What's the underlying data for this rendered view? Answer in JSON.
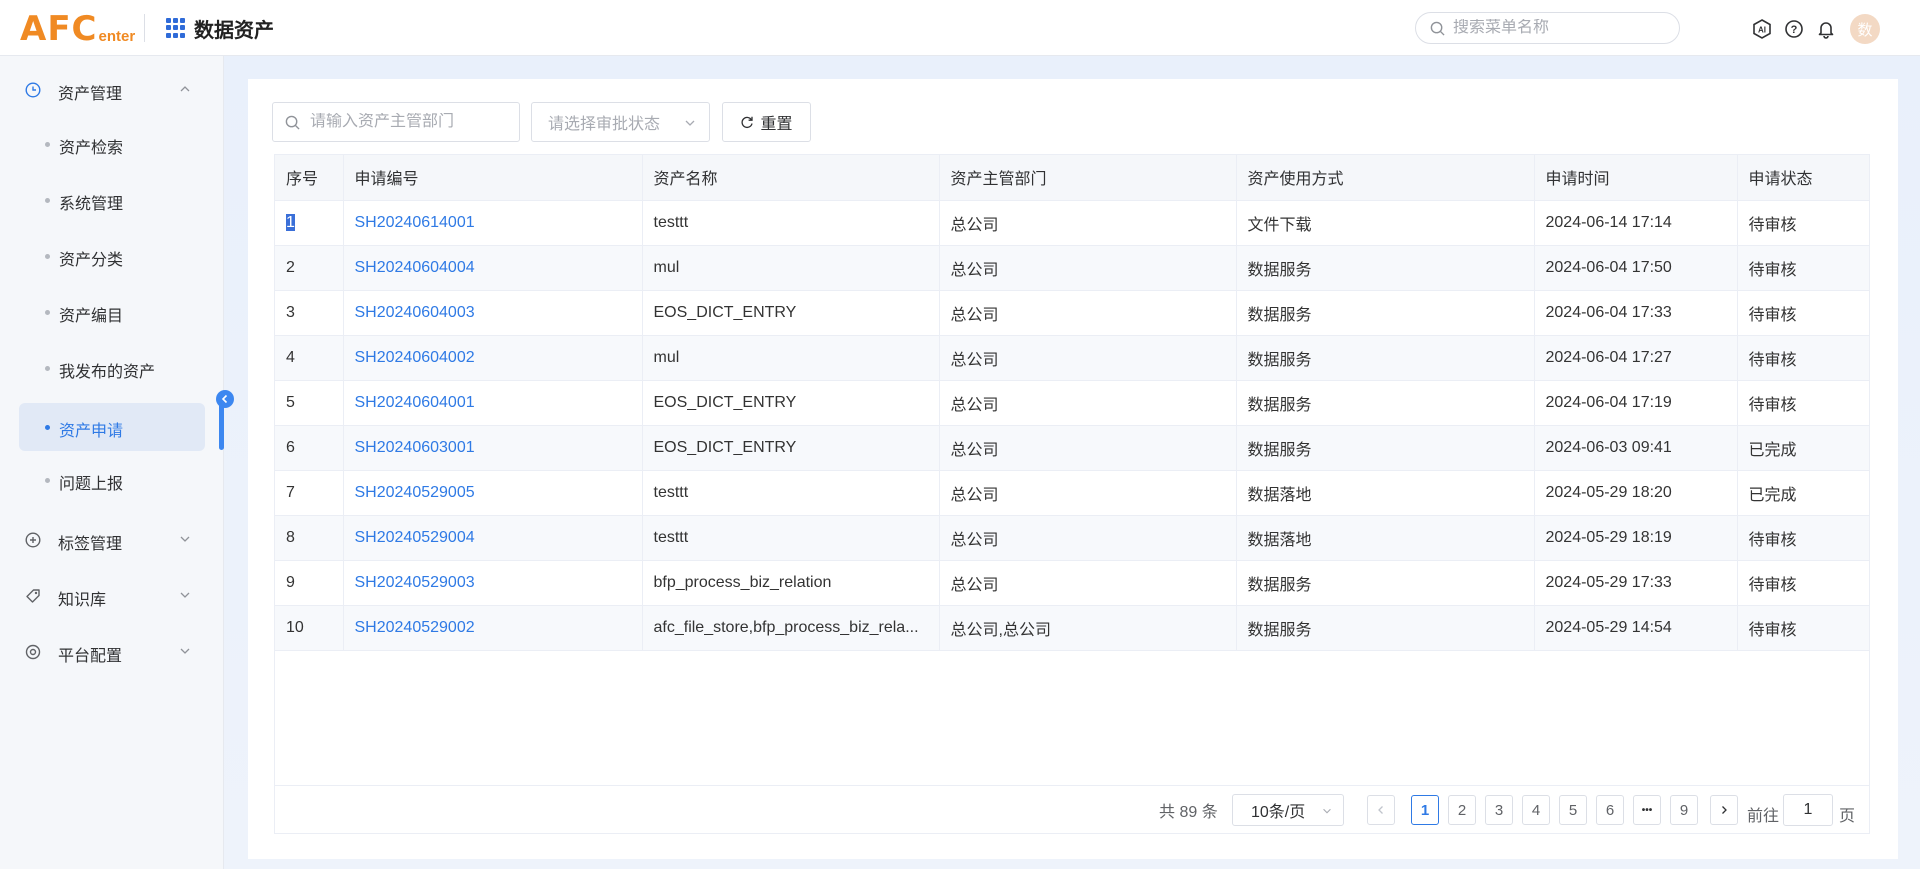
{
  "header": {
    "logo_big": "AFC",
    "logo_small": "enter",
    "app_title": "数据资产",
    "menu_search_placeholder": "搜索菜单名称",
    "avatar_text": "数"
  },
  "sidebar": {
    "groups": [
      {
        "label": "资产管理",
        "icon": "clock-icon",
        "expanded": true
      },
      {
        "label": "标签管理",
        "icon": "plus-circle-icon",
        "expanded": false
      },
      {
        "label": "知识库",
        "icon": "tag-icon",
        "expanded": false
      },
      {
        "label": "平台配置",
        "icon": "gear-icon",
        "expanded": false
      }
    ],
    "items": [
      {
        "label": "资产检索"
      },
      {
        "label": "系统管理"
      },
      {
        "label": "资产分类"
      },
      {
        "label": "资产编目"
      },
      {
        "label": "我发布的资产"
      },
      {
        "label": "资产申请",
        "active": true
      },
      {
        "label": "问题上报"
      }
    ]
  },
  "filters": {
    "dept_placeholder": "请输入资产主管部门",
    "status_placeholder": "请选择审批状态",
    "reset_label": "重置"
  },
  "table": {
    "headers": [
      "序号",
      "申请编号",
      "资产名称",
      "资产主管部门",
      "资产使用方式",
      "申请时间",
      "申请状态"
    ],
    "rows": [
      [
        "1",
        "SH20240614001",
        "testtt",
        "总公司",
        "文件下载",
        "2024-06-14 17:14",
        "待审核"
      ],
      [
        "2",
        "SH20240604004",
        "mul",
        "总公司",
        "数据服务",
        "2024-06-04 17:50",
        "待审核"
      ],
      [
        "3",
        "SH20240604003",
        "EOS_DICT_ENTRY",
        "总公司",
        "数据服务",
        "2024-06-04 17:33",
        "待审核"
      ],
      [
        "4",
        "SH20240604002",
        "mul",
        "总公司",
        "数据服务",
        "2024-06-04 17:27",
        "待审核"
      ],
      [
        "5",
        "SH20240604001",
        "EOS_DICT_ENTRY",
        "总公司",
        "数据服务",
        "2024-06-04 17:19",
        "待审核"
      ],
      [
        "6",
        "SH20240603001",
        "EOS_DICT_ENTRY",
        "总公司",
        "数据服务",
        "2024-06-03 09:41",
        "已完成"
      ],
      [
        "7",
        "SH20240529005",
        "testtt",
        "总公司",
        "数据落地",
        "2024-05-29 18:20",
        "已完成"
      ],
      [
        "8",
        "SH20240529004",
        "testtt",
        "总公司",
        "数据落地",
        "2024-05-29 18:19",
        "待审核"
      ],
      [
        "9",
        "SH20240529003",
        "bfp_process_biz_relation",
        "总公司",
        "数据服务",
        "2024-05-29 17:33",
        "待审核"
      ],
      [
        "10",
        "SH20240529002",
        "afc_file_store,bfp_process_biz_rela...",
        "总公司,总公司",
        "数据服务",
        "2024-05-29 14:54",
        "待审核"
      ]
    ]
  },
  "pagination": {
    "total_text": "共 89 条",
    "page_size": "10条/页",
    "pages": [
      "1",
      "2",
      "3",
      "4",
      "5",
      "6",
      "•••",
      "9"
    ],
    "current_page": "1",
    "goto_label": "前往",
    "goto_value": "1",
    "goto_unit": "页"
  },
  "colors": {
    "accent": "#2f7ae5",
    "logo": "#f08a23"
  }
}
